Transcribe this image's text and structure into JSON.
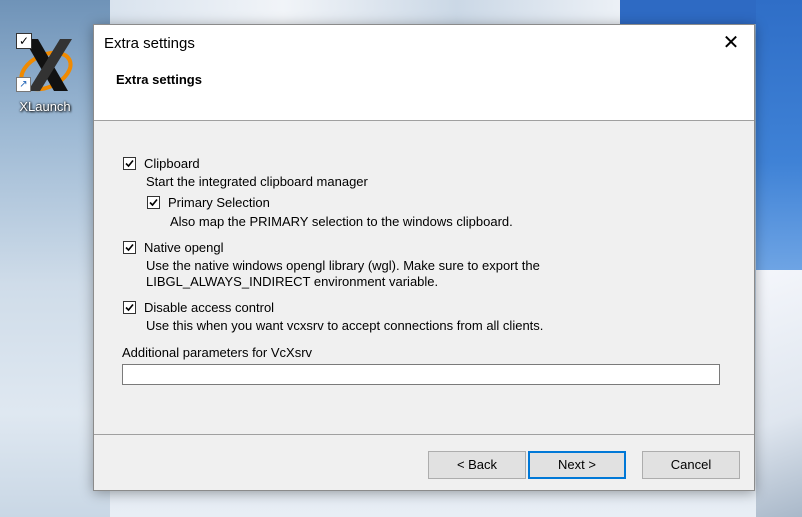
{
  "desktop": {
    "icon_label": "XLaunch",
    "icon_checked": true
  },
  "dialog": {
    "window_title": "Extra settings",
    "heading": "Extra settings",
    "options": [
      {
        "label": "Clipboard",
        "checked": true,
        "description": "Start the integrated clipboard manager"
      },
      {
        "label": "Primary Selection",
        "checked": true,
        "description": "Also map the PRIMARY selection to the windows clipboard."
      },
      {
        "label": "Native opengl",
        "checked": true,
        "description_lines": [
          "Use the native windows opengl library (wgl). Make sure to export the",
          "LIBGL_ALWAYS_INDIRECT environment variable."
        ]
      },
      {
        "label": "Disable access control",
        "checked": true,
        "description": "Use this when you want vcxsrv to accept connections from all clients."
      }
    ],
    "additional_params": {
      "label": "Additional parameters for VcXsrv",
      "value": ""
    },
    "buttons": {
      "back": "< Back",
      "next": "Next >",
      "cancel": "Cancel"
    }
  },
  "colors": {
    "accent": "#0078d7",
    "dialog_bg": "#f0f0f0",
    "button_bg": "#e1e1e1"
  }
}
